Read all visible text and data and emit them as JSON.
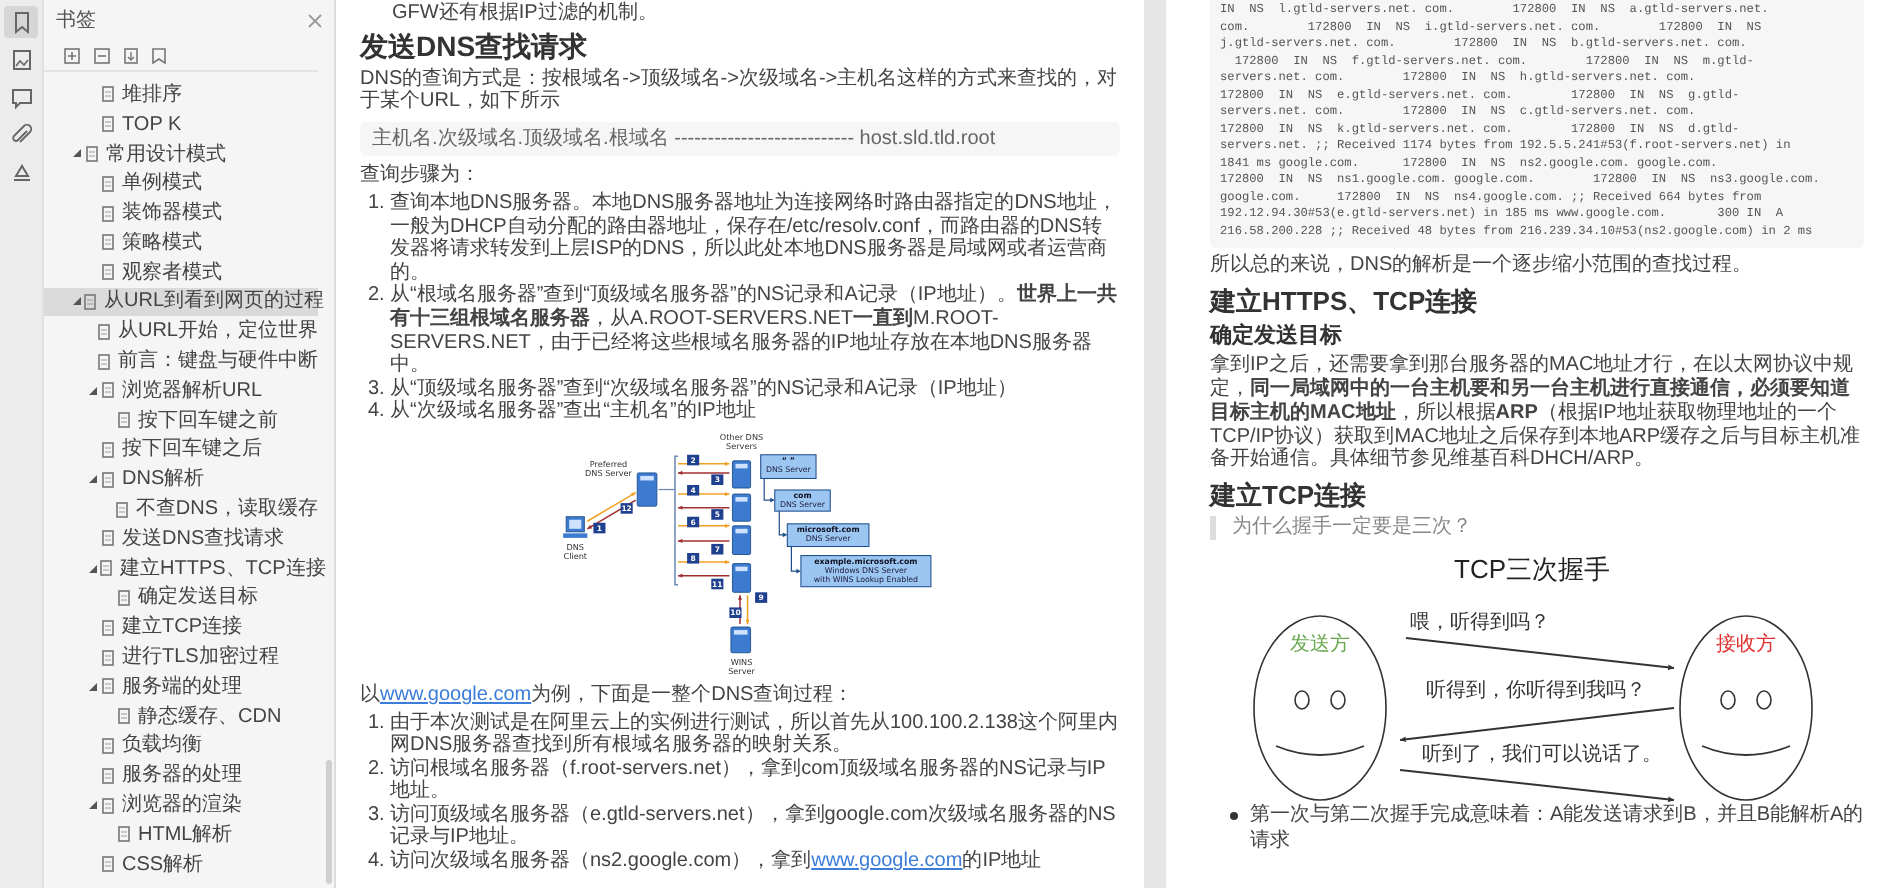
{
  "left_toolbar": [
    {
      "selected": true
    },
    {
      "selected": false
    },
    {
      "selected": false
    },
    {
      "selected": false
    },
    {
      "selected": false
    }
  ],
  "bookmarks_panel": {
    "title": "书签",
    "leading_children": [
      {
        "label": "堆排序",
        "selected": false
      },
      {
        "label": "TOP K",
        "selected": false
      }
    ],
    "items": [
      {
        "label": "常用设计模式",
        "selected": false,
        "expanded": true,
        "children": [
          {
            "label": "单例模式",
            "selected": false
          },
          {
            "label": "装饰器模式",
            "selected": false
          },
          {
            "label": "策略模式",
            "selected": false
          },
          {
            "label": "观察者模式",
            "selected": false
          }
        ]
      },
      {
        "label": "从URL到看到网页的过程",
        "selected": true,
        "expanded": true,
        "children": [
          {
            "label": "从URL开始，定位世界",
            "selected": false
          },
          {
            "label": "前言：键盘与硬件中断",
            "selected": false
          },
          {
            "label": "浏览器解析URL",
            "selected": false,
            "expanded": true,
            "children": [
              {
                "label": "按下回车键之前",
                "selected": false
              }
            ]
          },
          {
            "label": "按下回车键之后",
            "selected": false
          },
          {
            "label": "DNS解析",
            "selected": false,
            "expanded": true,
            "children": [
              {
                "label": "不查DNS，读取缓存",
                "selected": false
              }
            ]
          },
          {
            "label": "发送DNS查找请求",
            "selected": false
          },
          {
            "label": "建立HTTPS、TCP连接",
            "selected": false,
            "expanded": true,
            "children": [
              {
                "label": "确定发送目标",
                "selected": false
              }
            ]
          },
          {
            "label": "建立TCP连接",
            "selected": false
          },
          {
            "label": "进行TLS加密过程",
            "selected": false
          },
          {
            "label": "服务端的处理",
            "selected": false,
            "expanded": true,
            "children": [
              {
                "label": "静态缓存、CDN",
                "selected": false
              }
            ]
          },
          {
            "label": "负载均衡",
            "selected": false
          },
          {
            "label": "服务器的处理",
            "selected": false
          },
          {
            "label": "浏览器的渲染",
            "selected": false,
            "expanded": true,
            "children": [
              {
                "label": "HTML解析",
                "selected": false
              }
            ]
          },
          {
            "label": "CSS解析",
            "selected": false
          }
        ]
      }
    ]
  },
  "left_page": {
    "top_fragment": "GFW还有根据IP过滤的机制。",
    "heading": "发送DNS查找请求",
    "intro": "DNS的查询方式是：按根域名->顶级域名->次级域名->主机名这样的方式来查找的，对于某个URL，如下所示",
    "code": "主机名.次级域名.顶级域名.根域名 --------------------------- host.sld.tld.root",
    "steps_label": "查询步骤为：",
    "steps": [
      {
        "number": "1.",
        "text": "查询本地DNS服务器。本地DNS服务器地址为连接网络时路由器指定的DNS地址，一般为DHCP自动分配的路由器地址，保存在/etc/resolv.conf，而路由器的DNS转发器将请求转发到上层ISP的DNS，所以此处本地DNS服务器是局域网或者运营商的。"
      },
      {
        "number": "2.",
        "text": "从“根域名服务器”查到“顶级域名服务器”的NS记录和A记录（IP地址）。**世界上一共有十三组根域名服务器**，从A.ROOT-SERVERS.NET**一直到**M.ROOT-SERVERS.NET，由于已经将这些根域名服务器的IP地址存放在本地DNS服务器中。"
      },
      {
        "number": "3.",
        "text": "从“顶级域名服务器”查到“次级域名服务器”的NS记录和A记录（IP地址）"
      },
      {
        "number": "4.",
        "text": "从“次级域名服务器”查出“主机名”的IP地址"
      }
    ],
    "diagram": {
      "labels": [
        {
          "lines": [
            "Other DNS",
            "Servers"
          ]
        },
        {
          "lines": [
            "Preferred",
            "DNS Server"
          ]
        },
        {
          "lines": [
            "DNS",
            "Client"
          ]
        },
        {
          "lines": [
            "WINS",
            "Server"
          ]
        }
      ],
      "zones": [
        {
          "title": "“ ”",
          "lines": [
            "DNS Server"
          ]
        },
        {
          "title": "com",
          "lines": [
            "DNS Server"
          ]
        },
        {
          "title": "microsoft.com",
          "lines": [
            "DNS Server"
          ]
        },
        {
          "title": "example.microsoft.com",
          "lines": [
            "Windows DNS Server",
            "with WINS Lookup Enabled"
          ]
        }
      ],
      "steps": [
        "1",
        "12",
        "2",
        "3",
        "4",
        "5",
        "6",
        "7",
        "8",
        "11",
        "9",
        "10"
      ]
    },
    "example_intro": [
      {
        "text": "以",
        "link": false
      },
      {
        "text": "www.google.com",
        "link": true
      },
      {
        "text": "为例，下面是一整个DNS查询过程：",
        "link": false
      }
    ],
    "example_steps": [
      {
        "number": "1.",
        "segments": [
          {
            "text": "由于本次测试是在阿里云上的实例进行测试，所以首先从100.100.2.138这个阿里内网DNS服务器查找到所有根域名服务器的映射关系。",
            "link": false
          }
        ]
      },
      {
        "number": "2.",
        "segments": [
          {
            "text": "访问根域名服务器（f.root-servers.net），拿到com顶级域名服务器的NS记录与IP地址。",
            "link": false
          }
        ]
      },
      {
        "number": "3.",
        "segments": [
          {
            "text": "访问顶级域名服务器（e.gtld-servers.net），拿到google.com次级域名服务器的NS记录与IP地址。",
            "link": false
          }
        ]
      },
      {
        "number": "4.",
        "segments": [
          {
            "text": "访问次级域名服务器（ns2.google.com），拿到",
            "link": false
          },
          {
            "text": "www.google.com",
            "link": true
          },
          {
            "text": "的IP地址",
            "link": false
          }
        ]
      }
    ]
  },
  "right_page": {
    "code_lines": [
      "IN  NS  l.gtld-servers.net. com.        172800  IN  NS  a.gtld-servers.net.",
      "com.        172800  IN  NS  i.gtld-servers.net. com.        172800  IN  NS",
      "j.gtld-servers.net. com.        172800  IN  NS  b.gtld-servers.net. com.",
      "  172800  IN  NS  f.gtld-servers.net. com.        172800  IN  NS  m.gtld-",
      "servers.net. com.        172800  IN  NS  h.gtld-servers.net. com.",
      "172800  IN  NS  e.gtld-servers.net. com.        172800  IN  NS  g.gtld-",
      "servers.net. com.        172800  IN  NS  c.gtld-servers.net. com.",
      "172800  IN  NS  k.gtld-servers.net. com.        172800  IN  NS  d.gtld-",
      "servers.net. ;; Received 1174 bytes from 192.5.5.241#53(f.root-servers.net) in",
      "1841 ms google.com.      172800  IN  NS  ns2.google.com. google.com.",
      "172800  IN  NS  ns1.google.com. google.com.        172800  IN  NS  ns3.google.com.",
      "google.com.     172800  IN  NS  ns4.google.com. ;; Received 664 bytes from",
      "192.12.94.30#53(e.gtld-servers.net) in 185 ms www.google.com.       300 IN  A",
      "216.58.200.228 ;; Received 48 bytes from 216.239.34.10#53(ns2.google.com) in 2 ms"
    ],
    "summary": "所以总的来说，DNS的解析是一个逐步缩小范围的查找过程。",
    "heading": "建立HTTPS、TCP连接",
    "subheading": "确定发送目标",
    "paragraph": "拿到IP之后，还需要拿到那台服务器的MAC地址才行，在以太网协议中规定，**同一局域网中的一台主机要和另一台主机进行直接通信，必须要知道目标主机的MAC地址**，所以根据**ARP**（根据IP地址获取物理地址的一个TCP/IP协议）获取到MAC地址之后保存到本地ARP缓存之后与目标主机准备开始通信。具体细节参见维基百科DHCH/ARP。",
    "heading_2": "建立TCP连接",
    "quote": "为什么握手一定要是三次？",
    "figure": {
      "title": "TCP三次握手",
      "parties": [
        {
          "label": "发送方",
          "color": "#6aa84f"
        },
        {
          "label": "接收方",
          "color": "#e03030"
        }
      ],
      "messages": [
        "喂，听得到吗？",
        "听得到，你听得到我吗？",
        "听到了，我们可以说话了。"
      ]
    },
    "bullets": [
      "第一次与第二次握手完成意味着：A能发送请求到B，并且B能解析A的请求"
    ]
  }
}
